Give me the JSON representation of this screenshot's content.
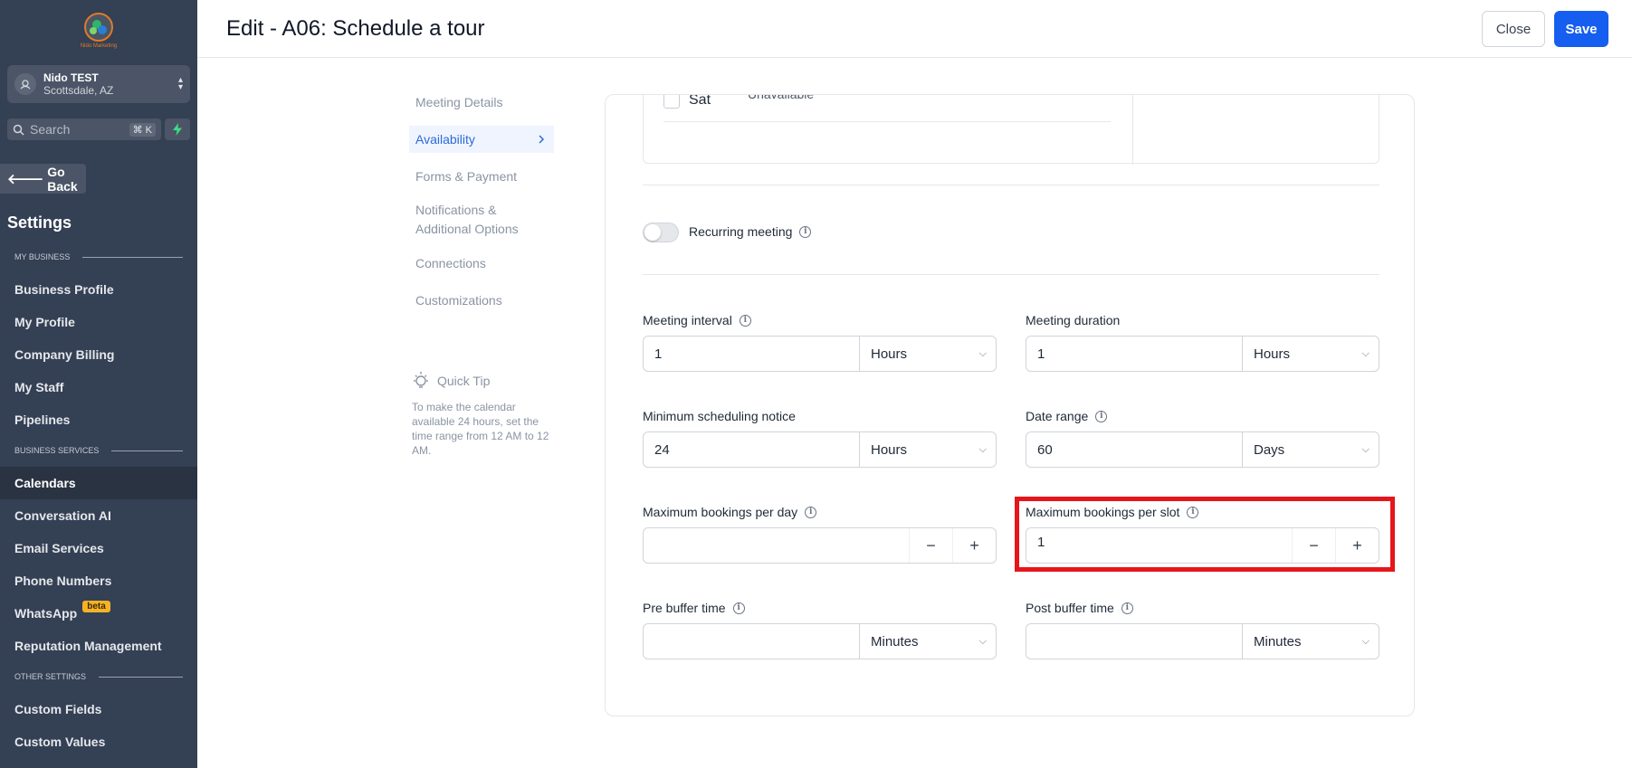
{
  "sidebar": {
    "logo_text": "Nido Marketing",
    "account": {
      "name": "Nido TEST",
      "location": "Scottsdale, AZ"
    },
    "search": {
      "placeholder": "Search",
      "shortcut": "⌘ K"
    },
    "go_back": "Go Back",
    "title": "Settings",
    "sections": [
      {
        "label": "MY BUSINESS",
        "items": [
          "Business Profile",
          "My Profile",
          "Company Billing",
          "My Staff",
          "Pipelines"
        ]
      },
      {
        "label": "BUSINESS SERVICES",
        "items": [
          "Calendars",
          "Conversation AI",
          "Email Services",
          "Phone Numbers",
          "WhatsApp",
          "Reputation Management"
        ]
      },
      {
        "label": "OTHER SETTINGS",
        "items": [
          "Custom Fields",
          "Custom Values"
        ]
      }
    ],
    "active_item": "Calendars",
    "beta_badge": "beta"
  },
  "header": {
    "title": "Edit - A06: Schedule a tour",
    "close_label": "Close",
    "save_label": "Save",
    "save_color": "#155eef"
  },
  "tabs": [
    {
      "label": "Meeting Details",
      "active": false
    },
    {
      "label": "Availability",
      "active": true
    },
    {
      "label": "Forms & Payment",
      "active": false
    },
    {
      "label": "Notifications & Additional Options",
      "active": false
    },
    {
      "label": "Connections",
      "active": false
    },
    {
      "label": "Customizations",
      "active": false
    }
  ],
  "quick_tip": {
    "title": "Quick Tip",
    "body": "To make the calendar available 24 hours, set the time range from 12 AM to 12 AM."
  },
  "availability": {
    "day": "Sat",
    "status": "Unavailable"
  },
  "recurring": {
    "label": "Recurring meeting",
    "enabled": false
  },
  "fields": {
    "meeting_interval": {
      "label": "Meeting interval",
      "value": "1",
      "unit": "Hours"
    },
    "meeting_duration": {
      "label": "Meeting duration",
      "value": "1",
      "unit": "Hours"
    },
    "min_notice": {
      "label": "Minimum scheduling notice",
      "value": "24",
      "unit": "Hours"
    },
    "date_range": {
      "label": "Date range",
      "value": "60",
      "unit": "Days"
    },
    "max_per_day": {
      "label": "Maximum bookings per day",
      "value": ""
    },
    "max_per_slot": {
      "label": "Maximum bookings per slot",
      "value": "1"
    },
    "pre_buffer": {
      "label": "Pre buffer time",
      "value": "",
      "unit": "Minutes"
    },
    "post_buffer": {
      "label": "Post buffer time",
      "value": "",
      "unit": "Minutes"
    }
  },
  "highlight_color": "#e5161b"
}
